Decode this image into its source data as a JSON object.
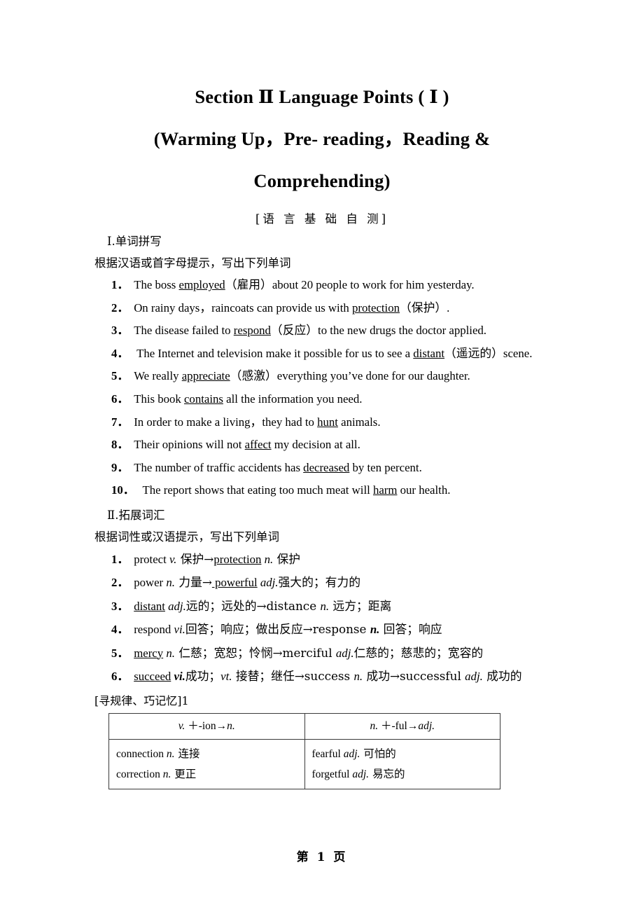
{
  "document": {
    "title_lines": [
      "Section Ⅱ    Language Points ( Ⅰ )",
      "(Warming Up，Pre- reading，Reading &",
      "Comprehending)"
    ],
    "banner": "[语 言 基 础 自 测]",
    "footer": "第 1 页"
  },
  "part_one": {
    "heading": "Ⅰ.单词拼写",
    "instruction": "根据汉语或首字母提示，写出下列单词",
    "items": [
      {
        "num": "1．",
        "pre": "The boss ",
        "key": "employed",
        "post": "（雇用）about 20 people to work for him yesterday."
      },
      {
        "num": "2．",
        "pre": "On rainy days，raincoats can provide us with ",
        "key": "protection",
        "post": "（保护）."
      },
      {
        "num": "3．",
        "pre": "The disease failed to ",
        "key": "respond",
        "post": "（反应）to the new drugs the doctor applied."
      },
      {
        "num": "4．",
        "pre": " The Internet and television make it possible for us to see a ",
        "key": "distant",
        "post": "（遥远的）scene."
      },
      {
        "num": "5．",
        "pre": "We really ",
        "key": "appreciate",
        "post": "（感激）everything you’ve done for our daughter."
      },
      {
        "num": "6．",
        "pre": "This book ",
        "key": "contains",
        "post": " all the information you need."
      },
      {
        "num": "7．",
        "pre": "In order to make a living，they had to ",
        "key": "hunt",
        "post": " animals."
      },
      {
        "num": "8．",
        "pre": "Their opinions will not ",
        "key": "affect",
        "post": " my decision at all."
      },
      {
        "num": "9．",
        "pre": "The number of traffic accidents has ",
        "key": "decreased",
        "post": " by ten percent."
      },
      {
        "num": "10．",
        "pre": " The report shows that eating too much meat will ",
        "key": "harm",
        "post": " our health."
      }
    ]
  },
  "part_two": {
    "heading": "Ⅱ.拓展词汇",
    "instruction": "根据词性或汉语提示，写出下列单词",
    "items": [
      {
        "num": "1．",
        "s1": "protect ",
        "pos1": "v.",
        "t1": " 保护→",
        "key": "protection",
        "keyUnderlined": true,
        "pos2": " n.",
        "t2": " 保护",
        "tail": ""
      },
      {
        "num": "2．",
        "s1": "power ",
        "pos1": "n.",
        "t1": " 力量→",
        "key": " powerful",
        "keyUnderlined": true,
        "pos2": " adj.",
        "t2": "强大的；有力的",
        "tail": ""
      },
      {
        "num": "3．",
        "s1": "",
        "pos1": "",
        "t1": "",
        "key": "distant",
        "keyUnderlined": true,
        "pos2": " adj.",
        "t2": "远的；远处的→distance ",
        "pos3": "n.",
        "t3": " 远方；距离",
        "tail": ""
      },
      {
        "num": "4．",
        "s1": "respond ",
        "pos1": "vi.",
        "t1": "回答；响应；做出反应→response ",
        "key": "",
        "keyUnderlined": false,
        "pos2": "n.",
        "t2": " 回答；响应",
        "tail": ""
      },
      {
        "num": "5．",
        "s1": "",
        "pos1": "",
        "t1": "",
        "key": "mercy",
        "keyUnderlined": true,
        "pos2": " n.",
        "t2": " 仁慈；宽恕；怜悯→merciful ",
        "pos3": "adj.",
        "t3": "仁慈的；慈悲的；宽容的",
        "tail": ""
      },
      {
        "num": "6．",
        "s1": "",
        "pos1": "",
        "t1": "",
        "key": "succeed",
        "keyUnderlined": true,
        "pos2": " vi.",
        "t2": "成功；",
        "pos3": "vt.",
        "t3": " 接替；继任→success ",
        "pos4": "n.",
        "t4": " 成功→successful ",
        "pos5": "adj.",
        "t5": " 成功的"
      }
    ]
  },
  "rule_box": {
    "label": "[寻规律、巧记忆]1",
    "headers": [
      {
        "pos": "v.",
        "rule": " ＋-ion→",
        "res": "n."
      },
      {
        "pos": "n.",
        "rule": " ＋-ful→",
        "res": "adj."
      }
    ],
    "rows": [
      {
        "left": [
          {
            "word": "connection ",
            "pos": "n.",
            "cn": " 连接"
          },
          {
            "word": "correction ",
            "pos": "n.",
            "cn": " 更正"
          }
        ],
        "right": [
          {
            "word": "fearful ",
            "pos": "adj.",
            "cn": " 可怕的"
          },
          {
            "word": "forgetful ",
            "pos": "adj.",
            "cn": " 易忘的"
          }
        ]
      }
    ]
  }
}
